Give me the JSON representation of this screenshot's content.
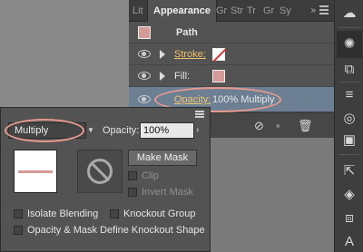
{
  "appearance": {
    "tabs": [
      "Lit",
      "Appearance",
      "Gr",
      "Str",
      "Tr",
      "Gr",
      "Sy"
    ],
    "more": "»",
    "path_label": "Path",
    "stroke_label": "Stroke:",
    "fill_label": "Fill:",
    "opacity_label": "Opacity:",
    "opacity_value": "100% Multiply",
    "swatch_color": "#d49a98"
  },
  "transparency": {
    "blend_mode": "Multiply",
    "opacity_label": "Opacity:",
    "opacity_value": "100%",
    "make_mask_label": "Make Mask",
    "clip_label": "Clip",
    "invert_mask_label": "Invert Mask",
    "isolate_blending_label": "Isolate Blending",
    "knockout_group_label": "Knockout Group",
    "opacity_mask_label": "Opacity & Mask Define Knockout Shape"
  },
  "highlight_color": "#e89a8e",
  "tools": [
    "cloud-icon",
    "sun-icon",
    "export-icon",
    "menu-icon",
    "circles-icon",
    "gradient-icon",
    "export-arrow-icon",
    "layers-icon",
    "artboards-icon",
    "char-icon"
  ],
  "tool_glyphs": [
    "☁",
    "✺",
    "⧉",
    "≡",
    "◎",
    "▣",
    "⇱",
    "◈",
    "⧈",
    "A"
  ]
}
